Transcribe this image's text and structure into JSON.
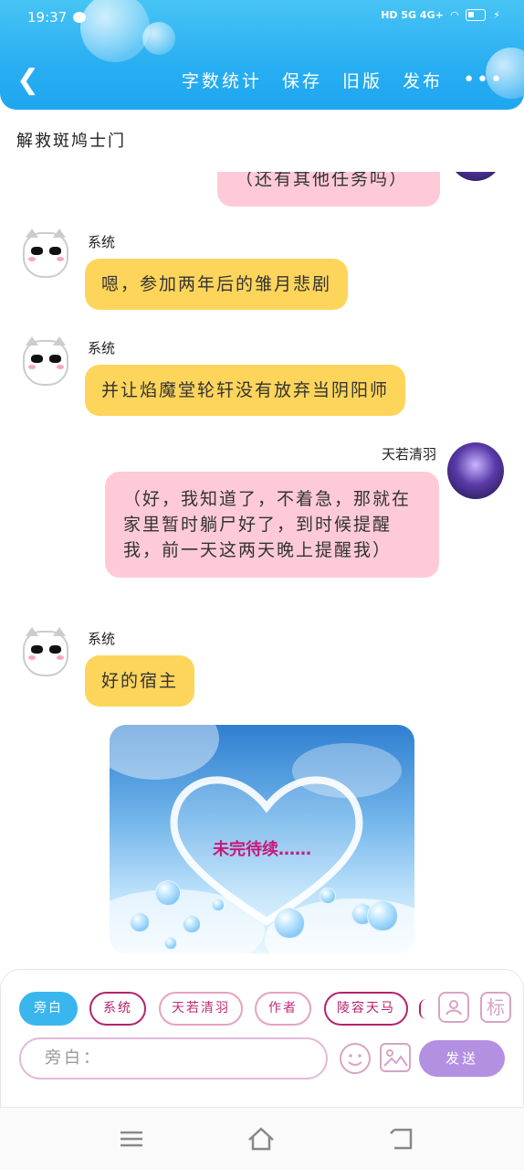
{
  "status": {
    "time": "19:37",
    "network": "HD 5G 4G+",
    "battery": "8"
  },
  "header": {
    "nav": [
      "字数统计",
      "保存",
      "旧版",
      "发布"
    ],
    "more": "•••"
  },
  "title": "解救斑鸠士门",
  "messages": [
    {
      "sender": "",
      "text": "（还有其他任务吗）",
      "side": "right",
      "color": "pink"
    },
    {
      "sender": "系统",
      "text": "嗯，参加两年后的雏月悲剧",
      "side": "left",
      "color": "yellow"
    },
    {
      "sender": "系统",
      "text": "并让焰魔堂轮轩没有放弃当阴阳师",
      "side": "left",
      "color": "yellow"
    },
    {
      "sender": "天若清羽",
      "text": "（好，我知道了，不着急，那就在家里暂时躺尸好了，到时候提醒我，前一天这两天晚上提醒我）",
      "side": "right",
      "color": "pink"
    },
    {
      "sender": "系统",
      "text": "好的宿主",
      "side": "left",
      "color": "yellow"
    }
  ],
  "picture": {
    "caption": "未完待续……"
  },
  "composer": {
    "roles": [
      "旁白",
      "系统",
      "天若清羽",
      "作者",
      "陵容天马"
    ],
    "icon_names": [
      "user-card-icon",
      "label-icon"
    ],
    "label_icon_text": "标",
    "placeholder": "旁白：",
    "send_label": "发送"
  }
}
